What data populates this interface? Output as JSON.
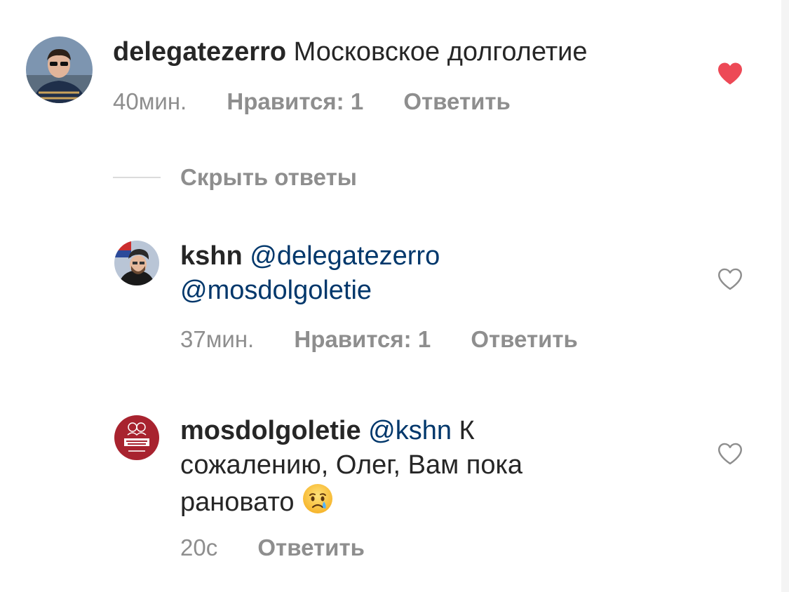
{
  "comments": [
    {
      "username": "delegatezerro",
      "text": "Московское долголетие",
      "time": "40мин.",
      "likes": "Нравится: 1",
      "reply": "Ответить",
      "liked": true
    },
    {
      "username": "kshn",
      "mention1": "@delegatezerro",
      "mention2": "@mosdolgoletie",
      "time": "37мин.",
      "likes": "Нравится: 1",
      "reply": "Ответить",
      "liked": false
    },
    {
      "username": "mosdolgoletie",
      "mention": "@kshn",
      "text_line1": "К",
      "text_line2": "сожалению, Олег, Вам пока",
      "text_line3": "рановато",
      "emoji": "crying-face",
      "time": "20с",
      "reply": "Ответить",
      "liked": false
    }
  ],
  "hide_replies_label": "Скрыть ответы",
  "colors": {
    "text": "#262626",
    "meta": "#8e8e8e",
    "mention": "#00376b",
    "heart_liked": "#ed4956",
    "heart_outline": "#8e8e8e"
  }
}
